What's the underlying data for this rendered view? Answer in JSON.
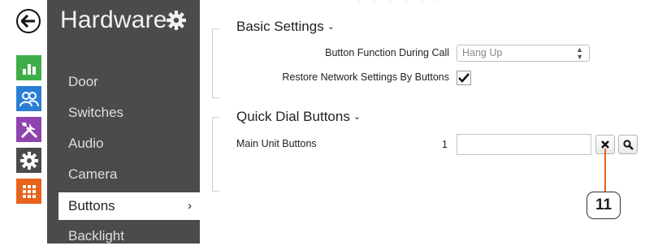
{
  "sidebar": {
    "title": "Hardware",
    "items": [
      {
        "label": "Door"
      },
      {
        "label": "Switches"
      },
      {
        "label": "Audio"
      },
      {
        "label": "Camera"
      },
      {
        "label": "Buttons",
        "chevron": "›",
        "active": true
      },
      {
        "label": "Backlight"
      }
    ]
  },
  "rail": {
    "icons": [
      {
        "name": "back-arrow-icon"
      },
      {
        "name": "status-chart-icon",
        "color": "#3fae49"
      },
      {
        "name": "directory-users-icon",
        "color": "#2a7fd4"
      },
      {
        "name": "services-tools-icon",
        "color": "#8e44ad"
      },
      {
        "name": "hardware-gear-icon",
        "color": "#4b4b4b"
      },
      {
        "name": "system-grid-icon",
        "color": "#e8631c"
      }
    ]
  },
  "basic_settings": {
    "title": "Basic Settings",
    "button_function_label": "Button Function During Call",
    "button_function_value": "Hang Up",
    "restore_label": "Restore Network Settings By Buttons",
    "restore_checked": true
  },
  "quick_dial": {
    "title": "Quick Dial Buttons",
    "main_unit_label": "Main Unit Buttons",
    "row_number": "1",
    "input_value": ""
  },
  "callout": {
    "number": "11",
    "color": "#e8631c"
  }
}
